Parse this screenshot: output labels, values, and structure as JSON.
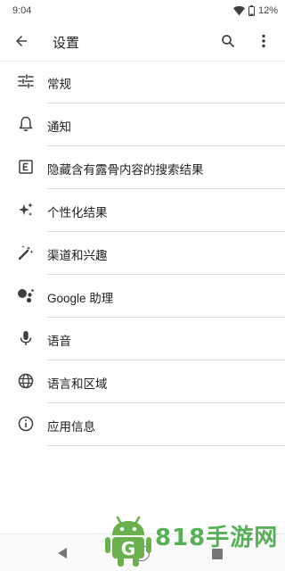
{
  "status_bar": {
    "time": "9:04",
    "battery": "12%"
  },
  "app_bar": {
    "title": "设置",
    "back_icon": "arrow-back-icon",
    "search_icon": "search-icon",
    "more_icon": "more-vert-icon"
  },
  "settings": {
    "items": [
      {
        "label": "常规",
        "icon": "tune-icon"
      },
      {
        "label": "通知",
        "icon": "bell-icon"
      },
      {
        "label": "隐藏含有露骨内容的搜索结果",
        "icon": "explicit-icon"
      },
      {
        "label": "个性化结果",
        "icon": "sparkle-icon"
      },
      {
        "label": "渠道和兴趣",
        "icon": "magic-wand-icon"
      },
      {
        "label": "Google 助理",
        "icon": "assistant-icon"
      },
      {
        "label": "语音",
        "icon": "microphone-icon"
      },
      {
        "label": "语言和区域",
        "icon": "globe-icon"
      },
      {
        "label": "应用信息",
        "icon": "info-icon"
      }
    ]
  },
  "nav_bar": {
    "back_icon": "nav-back-icon",
    "home_icon": "nav-home-icon",
    "recents_icon": "nav-recents-icon"
  },
  "watermark": {
    "text": "818手游网",
    "logo_letter": "G"
  }
}
